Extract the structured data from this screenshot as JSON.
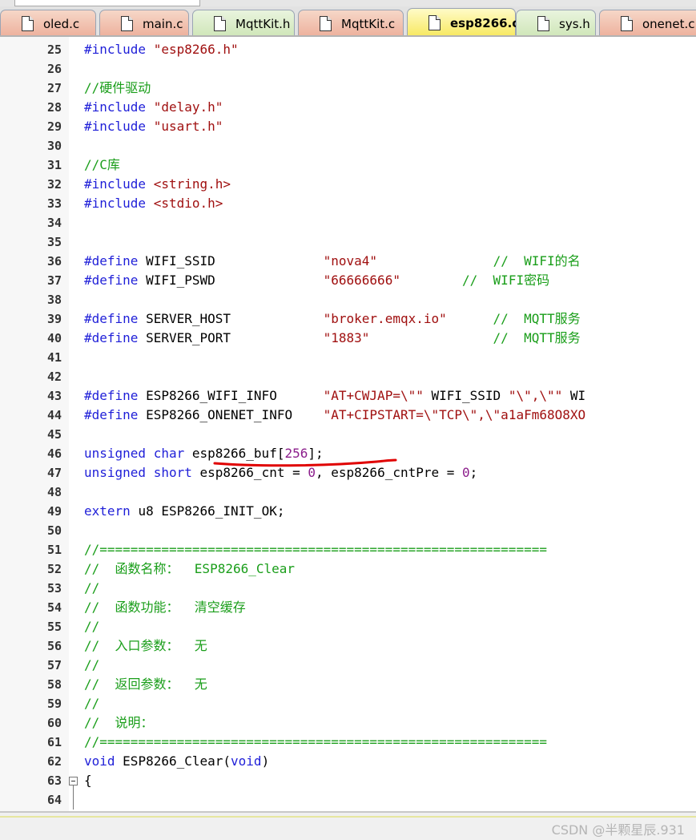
{
  "tabs": [
    {
      "name": "oled.c",
      "type": "c",
      "active": false
    },
    {
      "name": "main.c",
      "type": "c",
      "active": false
    },
    {
      "name": "MqttKit.h",
      "type": "h",
      "active": false
    },
    {
      "name": "MqttKit.c",
      "type": "c",
      "active": false
    },
    {
      "name": "esp8266.c",
      "type": "c",
      "active": true
    },
    {
      "name": "sys.h",
      "type": "h",
      "active": false
    },
    {
      "name": "onenet.c",
      "type": "c",
      "active": false
    }
  ],
  "lines": [
    {
      "n": "25",
      "tokens": [
        [
          "pp",
          "#include "
        ],
        [
          "st",
          "\"esp8266.h\""
        ]
      ]
    },
    {
      "n": "26",
      "tokens": []
    },
    {
      "n": "27",
      "tokens": [
        [
          "cm",
          "//硬件驱动"
        ]
      ]
    },
    {
      "n": "28",
      "tokens": [
        [
          "pp",
          "#include "
        ],
        [
          "st",
          "\"delay.h\""
        ]
      ]
    },
    {
      "n": "29",
      "tokens": [
        [
          "pp",
          "#include "
        ],
        [
          "st",
          "\"usart.h\""
        ]
      ]
    },
    {
      "n": "30",
      "tokens": []
    },
    {
      "n": "31",
      "tokens": [
        [
          "cm",
          "//C库"
        ]
      ]
    },
    {
      "n": "32",
      "tokens": [
        [
          "pp",
          "#include "
        ],
        [
          "st",
          "<string.h>"
        ]
      ]
    },
    {
      "n": "33",
      "tokens": [
        [
          "pp",
          "#include "
        ],
        [
          "st",
          "<stdio.h>"
        ]
      ]
    },
    {
      "n": "34",
      "tokens": []
    },
    {
      "n": "35",
      "tokens": []
    },
    {
      "n": "36",
      "tokens": [
        [
          "pp",
          "#define "
        ],
        [
          "tx",
          "WIFI_SSID              "
        ],
        [
          "st",
          "\"nova4\""
        ],
        [
          "tx",
          "               "
        ],
        [
          "cm",
          "//  WIFI的名"
        ]
      ]
    },
    {
      "n": "37",
      "tokens": [
        [
          "pp",
          "#define "
        ],
        [
          "tx",
          "WIFI_PSWD              "
        ],
        [
          "st",
          "\"66666666\""
        ],
        [
          "tx",
          "        "
        ],
        [
          "cm",
          "//  WIFI密码"
        ]
      ]
    },
    {
      "n": "38",
      "tokens": []
    },
    {
      "n": "39",
      "tokens": [
        [
          "pp",
          "#define "
        ],
        [
          "tx",
          "SERVER_HOST            "
        ],
        [
          "st",
          "\"broker.emqx.io\""
        ],
        [
          "tx",
          "      "
        ],
        [
          "cm",
          "//  MQTT服务"
        ]
      ]
    },
    {
      "n": "40",
      "tokens": [
        [
          "pp",
          "#define "
        ],
        [
          "tx",
          "SERVER_PORT            "
        ],
        [
          "st",
          "\"1883\""
        ],
        [
          "tx",
          "                "
        ],
        [
          "cm",
          "//  MQTT服务"
        ]
      ]
    },
    {
      "n": "41",
      "tokens": []
    },
    {
      "n": "42",
      "tokens": []
    },
    {
      "n": "43",
      "tokens": [
        [
          "pp",
          "#define "
        ],
        [
          "tx",
          "ESP8266_WIFI_INFO      "
        ],
        [
          "st",
          "\"AT+CWJAP=\\\"\""
        ],
        [
          "tx",
          " WIFI_SSID "
        ],
        [
          "st",
          "\"\\\",\\\"\""
        ],
        [
          "tx",
          " WI"
        ]
      ]
    },
    {
      "n": "44",
      "tokens": [
        [
          "pp",
          "#define "
        ],
        [
          "tx",
          "ESP8266_ONENET_INFO    "
        ],
        [
          "st",
          "\"AT+CIPSTART=\\\"TCP\\\",\\\"a1aFm68O8XO"
        ]
      ]
    },
    {
      "n": "45",
      "tokens": []
    },
    {
      "n": "46",
      "tokens": [
        [
          "kw",
          "unsigned char "
        ],
        [
          "tx",
          "esp8266_buf["
        ],
        [
          "num",
          "256"
        ],
        [
          "tx",
          "];"
        ]
      ]
    },
    {
      "n": "47",
      "tokens": [
        [
          "kw",
          "unsigned short "
        ],
        [
          "tx",
          "esp8266_cnt = "
        ],
        [
          "num",
          "0"
        ],
        [
          "tx",
          ", esp8266_cntPre = "
        ],
        [
          "num",
          "0"
        ],
        [
          "tx",
          ";"
        ]
      ]
    },
    {
      "n": "48",
      "tokens": []
    },
    {
      "n": "49",
      "tokens": [
        [
          "kw",
          "extern "
        ],
        [
          "tx",
          "u8 ESP8266_INIT_OK;"
        ]
      ]
    },
    {
      "n": "50",
      "tokens": []
    },
    {
      "n": "51",
      "tokens": [
        [
          "cm",
          "//=========================================================="
        ]
      ]
    },
    {
      "n": "52",
      "tokens": [
        [
          "cm",
          "//  函数名称：  ESP8266_Clear"
        ]
      ]
    },
    {
      "n": "53",
      "tokens": [
        [
          "cm",
          "//"
        ]
      ]
    },
    {
      "n": "54",
      "tokens": [
        [
          "cm",
          "//  函数功能：  清空缓存"
        ]
      ]
    },
    {
      "n": "55",
      "tokens": [
        [
          "cm",
          "//"
        ]
      ]
    },
    {
      "n": "56",
      "tokens": [
        [
          "cm",
          "//  入口参数：  无"
        ]
      ]
    },
    {
      "n": "57",
      "tokens": [
        [
          "cm",
          "//"
        ]
      ]
    },
    {
      "n": "58",
      "tokens": [
        [
          "cm",
          "//  返回参数：  无"
        ]
      ]
    },
    {
      "n": "59",
      "tokens": [
        [
          "cm",
          "//"
        ]
      ]
    },
    {
      "n": "60",
      "tokens": [
        [
          "cm",
          "//  说明："
        ]
      ]
    },
    {
      "n": "61",
      "tokens": [
        [
          "cm",
          "//=========================================================="
        ]
      ]
    },
    {
      "n": "62",
      "tokens": [
        [
          "kw",
          "void "
        ],
        [
          "tx",
          "ESP8266_Clear("
        ],
        [
          "kw",
          "void"
        ],
        [
          "tx",
          ")"
        ]
      ]
    },
    {
      "n": "63",
      "tokens": [
        [
          "tx",
          "{"
        ]
      ]
    },
    {
      "n": "64",
      "tokens": []
    }
  ],
  "watermark": "CSDN @半颗星辰.931",
  "colors": {
    "keyword": "#1f1fd8",
    "string": "#a01010",
    "comment": "#1a9e1a",
    "number": "#8b1d8b",
    "annotation": "#e00000"
  }
}
